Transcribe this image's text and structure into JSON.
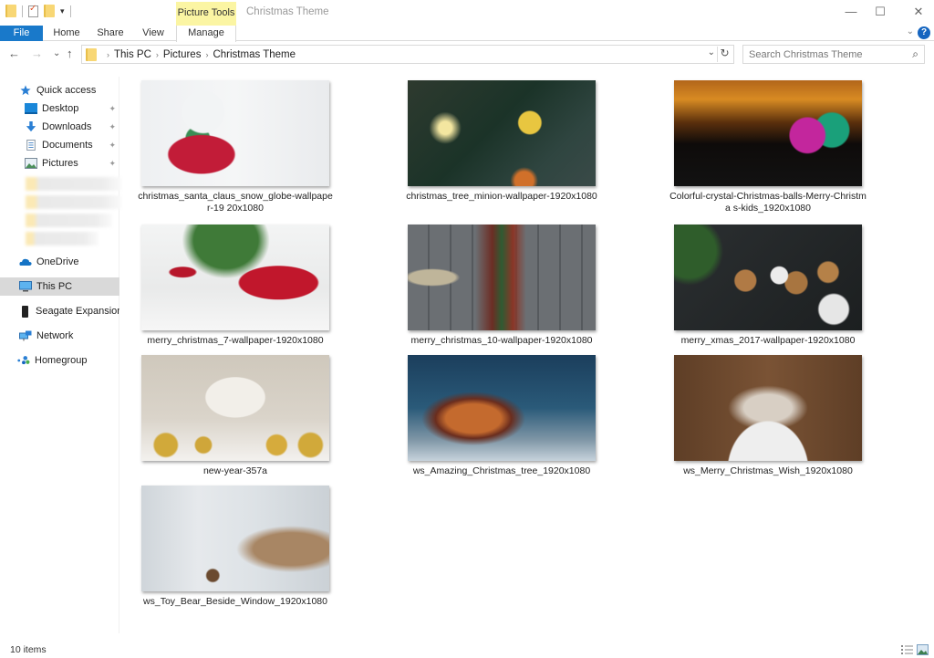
{
  "window": {
    "title": "Christmas Theme",
    "contextual_tab_group": "Picture Tools",
    "controls": {
      "minimize": "—",
      "maximize": "☐",
      "close": "✕"
    }
  },
  "quick_access_toolbar": {
    "dropdown_glyph": "▾"
  },
  "ribbon": {
    "tabs": [
      {
        "label": "File",
        "active": true
      },
      {
        "label": "Home"
      },
      {
        "label": "Share"
      },
      {
        "label": "View"
      },
      {
        "label": "Manage"
      }
    ],
    "collapse_glyph": "⌄",
    "help_glyph": "?"
  },
  "navigation": {
    "back_glyph": "←",
    "forward_glyph": "→",
    "recent_glyph": "⌄",
    "up_glyph": "↑",
    "breadcrumb": [
      "This PC",
      "Pictures",
      "Christmas Theme"
    ],
    "breadcrumb_sep": "›",
    "address_dropdown_glyph": "⌄",
    "refresh_glyph": "↻"
  },
  "search": {
    "placeholder": "Search Christmas Theme",
    "value": "",
    "icon_glyph": "⌕"
  },
  "sidebar": {
    "quick_access": {
      "label": "Quick access",
      "icon": "star-icon"
    },
    "pinned": [
      {
        "label": "Desktop",
        "icon": "desktop-icon",
        "pinned": true
      },
      {
        "label": "Downloads",
        "icon": "download-icon",
        "pinned": true
      },
      {
        "label": "Documents",
        "icon": "documents-icon",
        "pinned": true
      },
      {
        "label": "Pictures",
        "icon": "pictures-icon",
        "pinned": true
      }
    ],
    "pin_glyph": "📌",
    "blurred_items_count": 4,
    "locations": [
      {
        "label": "OneDrive",
        "icon": "cloud-icon"
      },
      {
        "label": "This PC",
        "icon": "computer-icon",
        "selected": true
      },
      {
        "label": "Seagate Expansion Drive",
        "icon": "drive-icon"
      },
      {
        "label": "Network",
        "icon": "network-icon"
      },
      {
        "label": "Homegroup",
        "icon": "homegroup-icon"
      }
    ]
  },
  "files": [
    {
      "name": "christmas_santa_claus_snow_globe-wallpaper-1920x1080",
      "display": "christmas_santa_claus_snow_globe-wallpaper-19 20x1080"
    },
    {
      "name": "christmas_tree_minion-wallpaper-1920x1080",
      "display": "christmas_tree_minion-wallpaper-1920x1080"
    },
    {
      "name": "Colorful-crystal-Christmas-balls-Merry-Christmas-kids_1920x1080",
      "display": "Colorful-crystal-Christmas-balls-Merry-Christma s-kids_1920x1080"
    },
    {
      "name": "merry_christmas_7-wallpaper-1920x1080",
      "display": "merry_christmas_7-wallpaper-1920x1080"
    },
    {
      "name": "merry_christmas_10-wallpaper-1920x1080",
      "display": "merry_christmas_10-wallpaper-1920x1080"
    },
    {
      "name": "merry_xmas_2017-wallpaper-1920x1080",
      "display": "merry_xmas_2017-wallpaper-1920x1080"
    },
    {
      "name": "new-year-357a",
      "display": "new-year-357a"
    },
    {
      "name": "ws_Amazing_Christmas_tree_1920x1080",
      "display": "ws_Amazing_Christmas_tree_1920x1080"
    },
    {
      "name": "ws_Merry_Christmas_Wish_1920x1080",
      "display": "ws_Merry_Christmas_Wish_1920x1080"
    },
    {
      "name": "ws_Toy_Bear_Beside_Window_1920x1080",
      "display": "ws_Toy_Bear_Beside_Window_1920x1080"
    }
  ],
  "status": {
    "item_count": "10 items"
  },
  "colors": {
    "accent": "#1979ca",
    "context_tab": "#fbf5a3",
    "selection": "#d9d9d9",
    "folder": "#f8d775"
  }
}
